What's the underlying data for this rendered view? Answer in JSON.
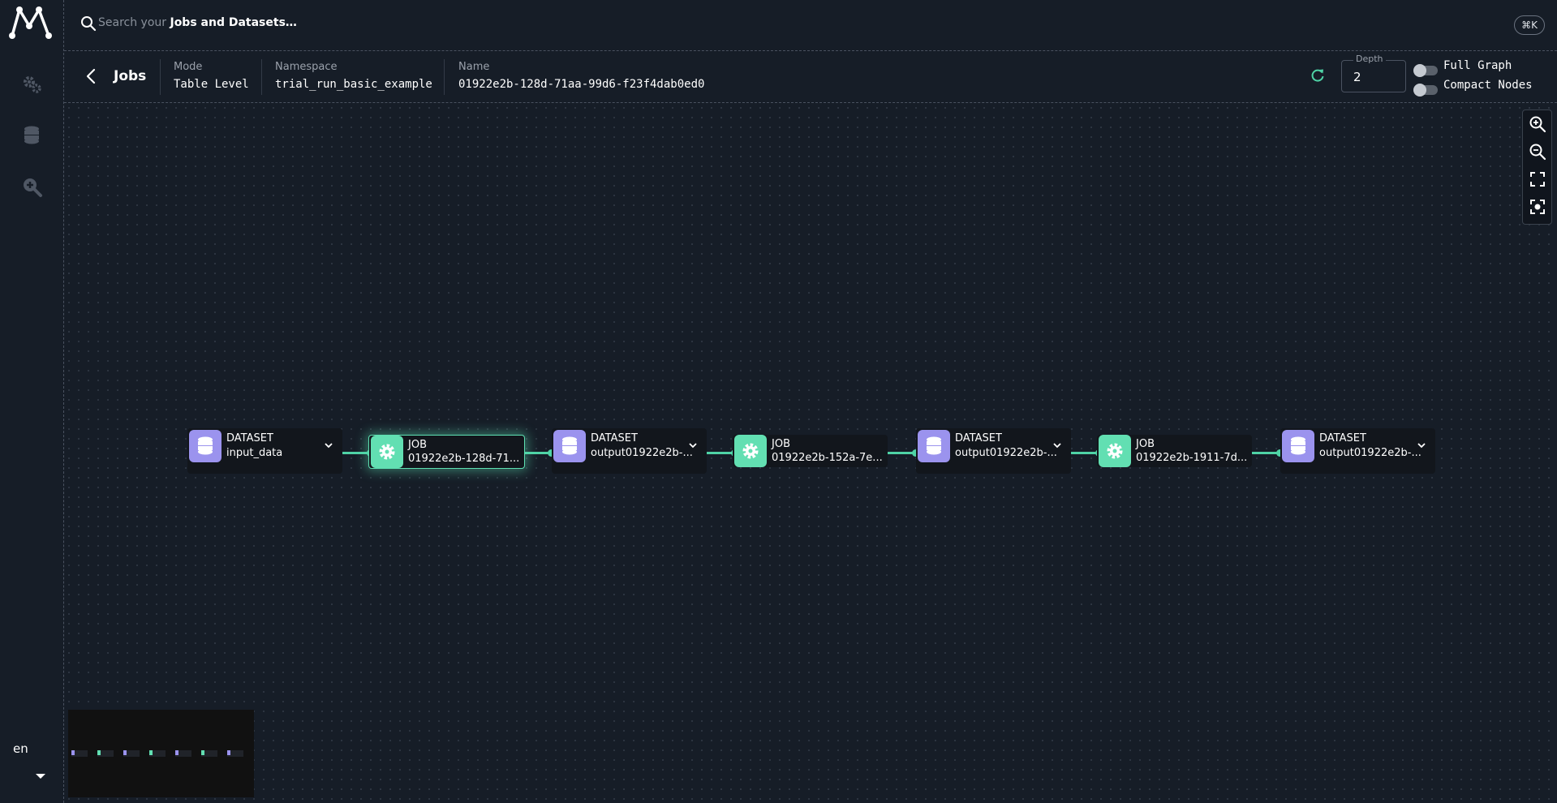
{
  "search": {
    "prefix": "Search your ",
    "emphasis": "Jobs and Datasets…",
    "shortcut": "⌘K"
  },
  "sidebar": {
    "items": [
      {
        "icon": "gears-icon",
        "label": ""
      },
      {
        "icon": "database-icon",
        "label": ""
      },
      {
        "icon": "search-zoom-icon",
        "label": ""
      }
    ],
    "language": "en"
  },
  "header": {
    "title": "Jobs",
    "mode_label": "Mode",
    "mode_value": "Table Level",
    "namespace_label": "Namespace",
    "namespace_value": "trial_run_basic_example",
    "name_label": "Name",
    "name_value": "01922e2b-128d-71aa-99d6-f23f4dab0ed0",
    "depth_label": "Depth",
    "depth_value": "2",
    "full_graph_label": "Full Graph",
    "compact_nodes_label": "Compact Nodes"
  },
  "graph": {
    "colors": {
      "dataset": "#9b93ee",
      "job": "#62dfb2",
      "edge": "#4fd3a6"
    },
    "nodes": [
      {
        "type": "DATASET",
        "name": "input_data"
      },
      {
        "type": "JOB",
        "name": "01922e2b-128d-71..."
      },
      {
        "type": "DATASET",
        "name": "output01922e2b-..."
      },
      {
        "type": "JOB",
        "name": "01922e2b-152a-7e..."
      },
      {
        "type": "DATASET",
        "name": "output01922e2b-..."
      },
      {
        "type": "JOB",
        "name": "01922e2b-1911-7d..."
      },
      {
        "type": "DATASET",
        "name": "output01922e2b-..."
      }
    ]
  }
}
